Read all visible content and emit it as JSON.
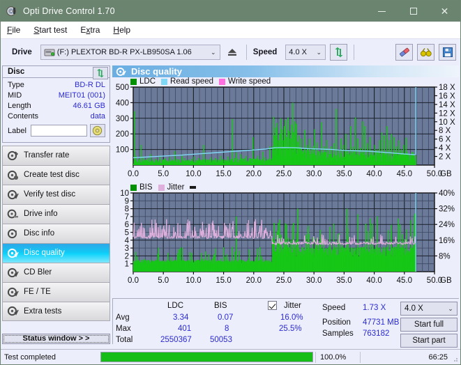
{
  "window": {
    "title": "Opti Drive Control 1.70",
    "icon": "disc-icon",
    "minimize": "—",
    "maximize": "□",
    "close": "✕"
  },
  "menu": {
    "items": [
      {
        "label": "File",
        "accel": "F"
      },
      {
        "label": "Start test",
        "accel": "S"
      },
      {
        "label": "Extra",
        "accel": "x"
      },
      {
        "label": "Help",
        "accel": "H"
      }
    ]
  },
  "toolbar": {
    "drive_label": "Drive",
    "drive_value": "(F:)   PLEXTOR BD-R  PX-LB950SA 1.06",
    "drive_icon": "drive-icon",
    "eject_icon": "eject-icon",
    "speed_label": "Speed",
    "speed_value": "4.0 X",
    "refresh_icon": "refresh-icon",
    "erase_icon": "eraser-icon",
    "glasses_icon": "glasses-icon",
    "save_icon": "floppy-save-icon",
    "caret": "⌄"
  },
  "disc_panel": {
    "title": "Disc",
    "refresh_icon": "refresh-icon",
    "rows": [
      {
        "key": "Type",
        "value": "BD-R DL"
      },
      {
        "key": "MID",
        "value": "MEIT01 (001)"
      },
      {
        "key": "Length",
        "value": "46.61 GB"
      },
      {
        "key": "Contents",
        "value": "data"
      }
    ],
    "label_key": "Label",
    "label_value": "",
    "label_placeholder": "",
    "label_button_icon": "disc-icon"
  },
  "nav": {
    "items": [
      {
        "label": "Transfer rate",
        "icon": "disc-transfer-icon",
        "active": false
      },
      {
        "label": "Create test disc",
        "icon": "disc-create-icon",
        "active": false
      },
      {
        "label": "Verify test disc",
        "icon": "disc-verify-icon",
        "active": false
      },
      {
        "label": "Drive info",
        "icon": "disc-drive-icon",
        "active": false
      },
      {
        "label": "Disc info",
        "icon": "disc-info-icon",
        "active": false
      },
      {
        "label": "Disc quality",
        "icon": "disc-quality-icon",
        "active": true
      },
      {
        "label": "CD Bler",
        "icon": "disc-bler-icon",
        "active": false
      },
      {
        "label": "FE / TE",
        "icon": "disc-fete-icon",
        "active": false
      },
      {
        "label": "Extra tests",
        "icon": "disc-extra-icon",
        "active": false
      }
    ],
    "status_window": "Status window > >"
  },
  "content": {
    "header_title": "Disc quality",
    "header_icon": "disc-quality-icon"
  },
  "stats": {
    "col_ldc": "LDC",
    "col_bis": "BIS",
    "jitter_label": "Jitter",
    "jitter_checked": true,
    "rows": [
      {
        "name": "Avg",
        "ldc": "3.34",
        "bis": "0.07",
        "jitter": "16.0%"
      },
      {
        "name": "Max",
        "ldc": "401",
        "bis": "8",
        "jitter": "25.5%"
      },
      {
        "name": "Total",
        "ldc": "2550367",
        "bis": "50053",
        "jitter": ""
      }
    ],
    "speed_label": "Speed",
    "speed_value": "1.73 X",
    "position_label": "Position",
    "position_value": "47731 MB",
    "samples_label": "Samples",
    "samples_value": "763182",
    "speed_select": "4.0 X",
    "start_full": "Start full",
    "start_part": "Start part",
    "caret": "⌄"
  },
  "statusbar": {
    "text": "Test completed",
    "percent": "100.0%",
    "progress": 100,
    "time": "66:25"
  },
  "colors": {
    "titlebar": "#6b8470",
    "window_bg": "#eceefb",
    "plot_bg": "#6b7a99",
    "ldc_green": "#17c717",
    "bis_green": "#17c717",
    "read_speed": "#7fd8f5",
    "write_speed": "#ff6fe0",
    "jitter_pink": "#e0b0dd",
    "accent_blue": "#2b2bd0",
    "progress_green": "#16bd16",
    "nav_active": "#12c8f4"
  },
  "chart_data": [
    {
      "type": "line",
      "id": "top-chart",
      "title": "",
      "legend": [
        {
          "label": "LDC",
          "color": "#009000"
        },
        {
          "label": "Read speed",
          "color": "#7fd8f5"
        },
        {
          "label": "Write speed",
          "color": "#ff6fe0"
        }
      ],
      "legend_position": "top-left",
      "grid": true,
      "xlabel": "GB",
      "xlim": [
        0,
        50
      ],
      "xticks": [
        "0.0",
        "5.0",
        "10.0",
        "15.0",
        "20.0",
        "25.0",
        "30.0",
        "35.0",
        "40.0",
        "45.0",
        "50.0"
      ],
      "ylabel_left": "LDC",
      "ylim_left": [
        0,
        500
      ],
      "yticks_left": [
        "100",
        "200",
        "300",
        "400",
        "500"
      ],
      "ylabel_right": "Speed",
      "ylim_right": [
        0,
        18
      ],
      "yticks_right": [
        "2 X",
        "4 X",
        "6 X",
        "8 X",
        "10 X",
        "12 X",
        "14 X",
        "16 X",
        "18 X"
      ],
      "series": [
        {
          "name": "LDC",
          "type": "bar",
          "color": "#17c717",
          "x": [
            0.1,
            0.4,
            0.8,
            1.2,
            1.6,
            2.0,
            2.4,
            2.8,
            3.2,
            3.6,
            4.0,
            4.4,
            4.8,
            5.2,
            5.6,
            6.0,
            6.4,
            6.8,
            7.2,
            7.6,
            8.0,
            8.4,
            8.8,
            9.2,
            9.6,
            10.0,
            10.4,
            10.8,
            11.2,
            11.6,
            12.0,
            12.4,
            12.8,
            13.2,
            13.6,
            14.0,
            14.4,
            14.8,
            15.2,
            15.6,
            16.0,
            16.4,
            16.8,
            17.0,
            17.4,
            17.8,
            18.2,
            18.6,
            19.0,
            19.4,
            19.8,
            20.2,
            20.6,
            21.0,
            21.4,
            21.8,
            22.2,
            22.6,
            23.0,
            23.2,
            23.4,
            23.6,
            23.8,
            24.0,
            24.2,
            24.4,
            24.6,
            24.8,
            25.0,
            25.2,
            25.4,
            25.6,
            25.8,
            26.0,
            26.2,
            26.4,
            26.6,
            26.8,
            27.0,
            27.2,
            27.4,
            27.6,
            27.8,
            28.0,
            28.4,
            28.8,
            29.2,
            29.6,
            30.0,
            30.4,
            30.8,
            31.2,
            31.6,
            32.0,
            32.4,
            32.8,
            33.2,
            33.6,
            34.0,
            34.4,
            34.8,
            35.2,
            35.6,
            36.0,
            36.4,
            36.8,
            37.2,
            37.6,
            38.0,
            38.4,
            38.8,
            39.2,
            39.6,
            40.0,
            40.4,
            40.8,
            41.2,
            41.6,
            42.0,
            42.4,
            42.8,
            43.2,
            43.6,
            44.0,
            44.4,
            44.8,
            45.2,
            45.6,
            46.0,
            46.4,
            46.8
          ],
          "values": [
            345,
            60,
            40,
            130,
            55,
            35,
            45,
            70,
            35,
            40,
            30,
            60,
            35,
            45,
            30,
            50,
            35,
            90,
            40,
            35,
            60,
            45,
            30,
            35,
            40,
            55,
            30,
            45,
            35,
            130,
            40,
            35,
            50,
            30,
            45,
            35,
            60,
            40,
            30,
            55,
            35,
            295,
            45,
            80,
            35,
            70,
            40,
            60,
            30,
            45,
            180,
            35,
            60,
            40,
            85,
            50,
            35,
            120,
            45,
            310,
            190,
            240,
            270,
            160,
            200,
            300,
            230,
            160,
            250,
            290,
            180,
            305,
            220,
            170,
            260,
            400,
            210,
            280,
            265,
            150,
            190,
            110,
            170,
            90,
            225,
            130,
            170,
            110,
            230,
            145,
            90,
            275,
            120,
            160,
            105,
            120,
            140,
            360,
            100,
            170,
            130,
            200,
            95,
            250,
            120,
            305,
            170,
            110,
            280,
            250,
            140,
            180,
            95,
            130,
            100,
            160,
            210,
            190,
            250,
            160,
            200,
            180,
            120,
            160,
            100,
            130,
            175
          ]
        },
        {
          "name": "Read speed",
          "type": "line",
          "color": "#7fd8f5",
          "x": [
            0.0,
            2.0,
            4.0,
            6.0,
            8.0,
            10.0,
            12.0,
            14.0,
            16.0,
            18.0,
            20.0,
            22.0,
            23.5,
            25.0,
            27.0,
            29.0,
            31.0,
            33.0,
            35.0,
            37.0,
            39.0,
            41.0,
            43.0,
            45.0,
            46.8,
            46.9
          ],
          "values_speed": [
            1.7,
            1.85,
            2.0,
            2.15,
            2.3,
            2.5,
            2.7,
            2.9,
            3.1,
            3.3,
            3.5,
            3.7,
            4.0,
            4.05,
            4.0,
            3.8,
            3.7,
            3.6,
            3.4,
            3.3,
            3.2,
            3.0,
            2.8,
            2.55,
            2.4,
            18.0
          ]
        }
      ]
    },
    {
      "type": "line",
      "id": "bottom-chart",
      "title": "",
      "legend": [
        {
          "label": "BIS",
          "color": "#009000"
        },
        {
          "label": "Jitter",
          "color": "#e0b0dd"
        }
      ],
      "legend_position": "top-left",
      "grid": true,
      "xlabel": "GB",
      "xlim": [
        0,
        50
      ],
      "xticks": [
        "0.0",
        "5.0",
        "10.0",
        "15.0",
        "20.0",
        "25.0",
        "30.0",
        "35.0",
        "40.0",
        "45.0",
        "50.0"
      ],
      "ylabel_left": "BIS",
      "ylim_left": [
        0,
        10
      ],
      "yticks_left": [
        "1",
        "2",
        "3",
        "4",
        "5",
        "6",
        "7",
        "8",
        "9",
        "10"
      ],
      "ylabel_right": "Jitter",
      "ylim_right": [
        0,
        40
      ],
      "yticks_right": [
        "8%",
        "16%",
        "24%",
        "32%",
        "40%"
      ],
      "series": [
        {
          "name": "BIS",
          "type": "bar",
          "color": "#17c717"
        },
        {
          "name": "Jitter",
          "type": "line",
          "color": "#e0b0dd",
          "avg_first_half_pct": 17.5,
          "avg_second_half_pct": 14.5
        }
      ]
    }
  ]
}
